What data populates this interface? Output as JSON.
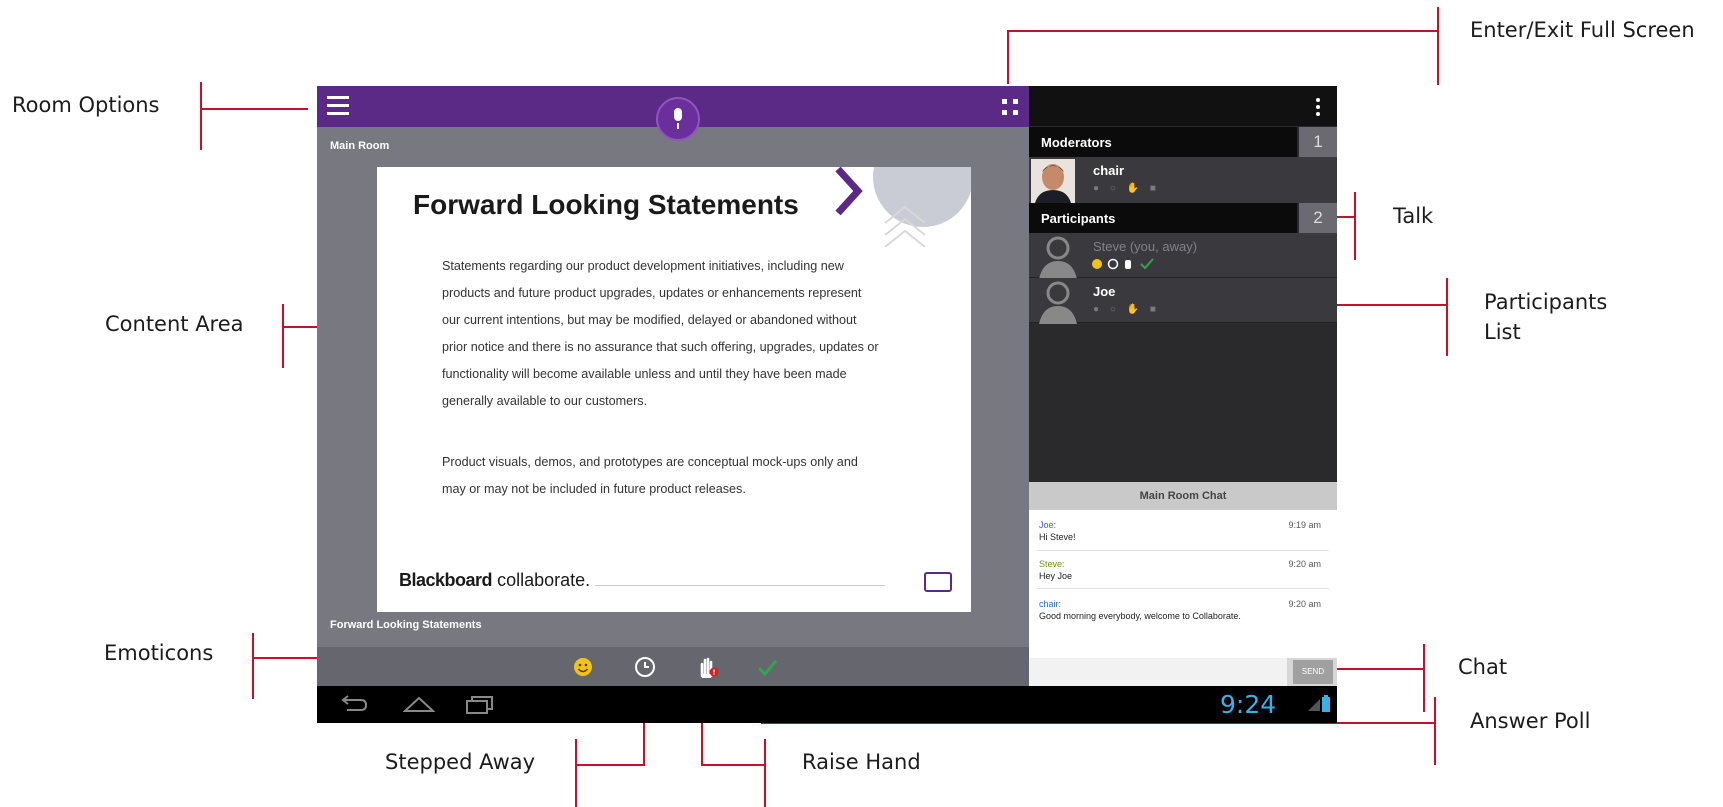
{
  "callouts": {
    "room_options": "Room Options",
    "content_area": "Content Area",
    "emoticons": "Emoticons",
    "stepped_away": "Stepped Away",
    "raise_hand": "Raise Hand",
    "answer_poll": "Answer Poll",
    "chat": "Chat",
    "participants_list_1": "Participants",
    "participants_list_2": "List",
    "talk": "Talk",
    "fullscreen": "Enter/Exit Full Screen"
  },
  "app": {
    "room_label": "Main Room",
    "slide_footer_label": "Forward Looking Statements",
    "slide": {
      "title": "Forward Looking Statements",
      "para1": "Statements regarding our product development initiatives, including new products and future product upgrades, updates or enhancements represent our current intentions, but may be modified, delayed or abandoned without prior notice and there is no assurance that such offering, upgrades, updates or functionality will become available unless and until they have been made generally available to our customers.",
      "para2": "Product visuals, demos, and prototypes are conceptual mock-ups only and may or may not be included in future product releases.",
      "logo_bold": "Blackboard",
      "logo_light": "collaborate."
    },
    "sidebar": {
      "moderators": {
        "label": "Moderators",
        "count": "1"
      },
      "participants": {
        "label": "Participants",
        "count": "2"
      },
      "moderator_list": [
        {
          "name": "chair"
        }
      ],
      "participant_list": [
        {
          "name": "Steve (you, away)"
        },
        {
          "name": "Joe"
        }
      ]
    },
    "chat": {
      "title": "Main Room Chat",
      "messages": [
        {
          "who": "Joe:",
          "time": "9:19 am",
          "text": "Hi Steve!"
        },
        {
          "who": "Steve:",
          "time": "9:20 am",
          "text": "Hey Joe"
        },
        {
          "who": "chair:",
          "time": "9:20 am",
          "text": "Good morning everybody, welcome to Collaborate."
        }
      ],
      "send_label": "SEND"
    },
    "clock": "9:24"
  },
  "colors": {
    "brand_purple": "#5b2a86",
    "callout_line": "#c8102e",
    "clock_blue": "#39b1e6"
  }
}
